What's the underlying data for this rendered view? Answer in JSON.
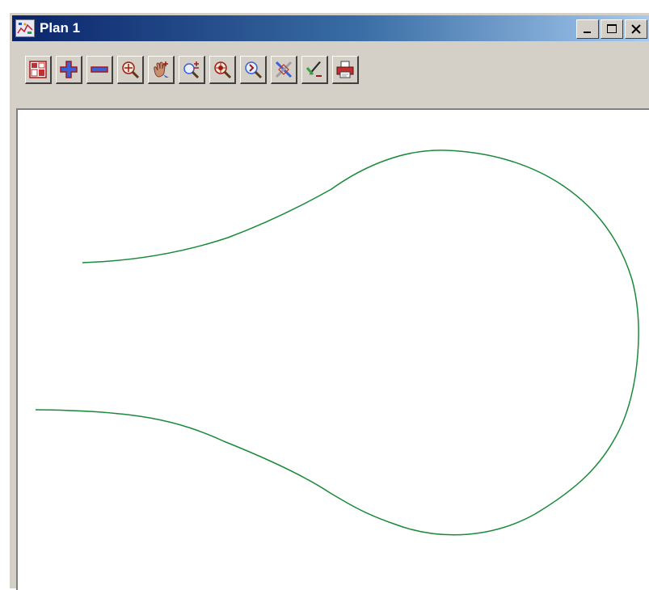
{
  "window": {
    "title": "Plan 1"
  },
  "caption_buttons": [
    {
      "name": "minimize",
      "icon": "minimize-icon"
    },
    {
      "name": "maximize",
      "icon": "maximize-icon"
    },
    {
      "name": "close",
      "icon": "close-icon"
    }
  ],
  "toolbar": {
    "buttons": [
      {
        "icon": "plot-view-icon"
      },
      {
        "icon": "zoom-in-plus-icon"
      },
      {
        "icon": "zoom-out-minus-icon"
      },
      {
        "icon": "zoom-extents-icon"
      },
      {
        "icon": "pan-hand-icon"
      },
      {
        "icon": "zoom-incremental-icon"
      },
      {
        "icon": "zoom-target-icon"
      },
      {
        "icon": "zoom-previous-icon"
      },
      {
        "icon": "clear-view-icon"
      },
      {
        "icon": "edit-pen-icon"
      },
      {
        "icon": "print-icon"
      }
    ]
  },
  "colors": {
    "curve": "#1a8a3a",
    "titlebar_start": "#0a246a",
    "titlebar_end": "#a6caf0",
    "chrome": "#d4d0c8"
  }
}
